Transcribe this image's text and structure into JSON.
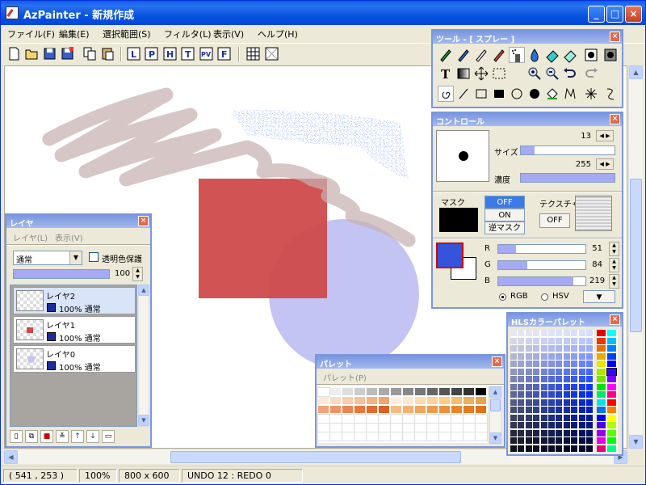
{
  "window": {
    "title": "AzPainter - 新規作成",
    "minimize": "_",
    "maximize": "□",
    "close": "×"
  },
  "menu": [
    "ファイル(F)",
    "編集(E)",
    "選択範囲(S)",
    "フィルタ(L)",
    "表示(V)",
    "ヘルプ(H)"
  ],
  "toolbar_icons": [
    "new-icon",
    "open-icon",
    "save-icon",
    "save-as-icon",
    "copy-icon",
    "paste-icon",
    "layer-l-icon",
    "layer-p-icon",
    "layer-h-icon",
    "layer-t-icon",
    "layer-pv-icon",
    "layer-f-icon",
    "grid-icon",
    "checker-icon"
  ],
  "tool_window": {
    "title": "ツール - [ スプレー ]",
    "row1": [
      "pen-icon",
      "pen2-icon",
      "pencil-icon",
      "brush-icon",
      "spray-icon",
      "drop-icon",
      "eraser-icon",
      "eraser2-icon",
      "blur-icon",
      "smudge-icon"
    ],
    "row2": [
      "text-icon",
      "gradient-icon",
      "move-icon",
      "select-icon",
      "zoom-in-icon",
      "zoom-out-icon",
      "undo-icon",
      "redo-icon"
    ],
    "row3": [
      "spiral-icon",
      "line-icon",
      "rect-icon",
      "fill-rect-icon",
      "ellipse-icon",
      "fill-ellipse-icon",
      "bucket-icon",
      "polyline-icon",
      "star-icon",
      "curve-icon"
    ]
  },
  "control_window": {
    "title": "コントロール",
    "size_label": "サイズ",
    "size_value": "13",
    "density_label": "濃度",
    "density_value": "255",
    "mask_label": "マスク",
    "mask_off": "OFF",
    "mask_on": "ON",
    "mask_reverse": "逆マスク",
    "texture_label": "テクスチャ",
    "texture_off": "OFF",
    "r_label": "R",
    "r_value": "51",
    "g_label": "G",
    "g_value": "84",
    "b_label": "B",
    "b_value": "219",
    "rgb_label": "RGB",
    "hsv_label": "HSV",
    "size_fill": 0.15,
    "density_fill": 1.0,
    "r_fill": 0.2,
    "g_fill": 0.33,
    "b_fill": 0.86,
    "fg_color": "#3354db",
    "bg_color": "#ffffff"
  },
  "layer_window": {
    "title": "レイヤ",
    "menu_layer": "レイヤ(L)",
    "menu_view": "表示(V)",
    "blend_mode": "通常",
    "preserve_alpha": "透明色保護",
    "opacity": "100",
    "layers": [
      {
        "name": "レイヤ2",
        "info": "100% 通常",
        "selected": true
      },
      {
        "name": "レイヤ1",
        "info": "100% 通常",
        "selected": false
      },
      {
        "name": "レイヤ0",
        "info": "100% 通常",
        "selected": false
      }
    ]
  },
  "palette_window": {
    "title": "パレット",
    "menu": "パレット(P)"
  },
  "hls_window": {
    "title": "HLSカラーパレット"
  },
  "status": {
    "coords": "( 541 , 253 )",
    "zoom": "100%",
    "size": "800 x 600",
    "undo": "UNDO  12 : REDO   0"
  },
  "colors": {
    "accent": "#0a54e0",
    "rect_fill": "#d04a4a",
    "circle_fill": "#c4c4f4",
    "stroke_color": "#c8b4b4",
    "spray_color": "#3354db"
  }
}
